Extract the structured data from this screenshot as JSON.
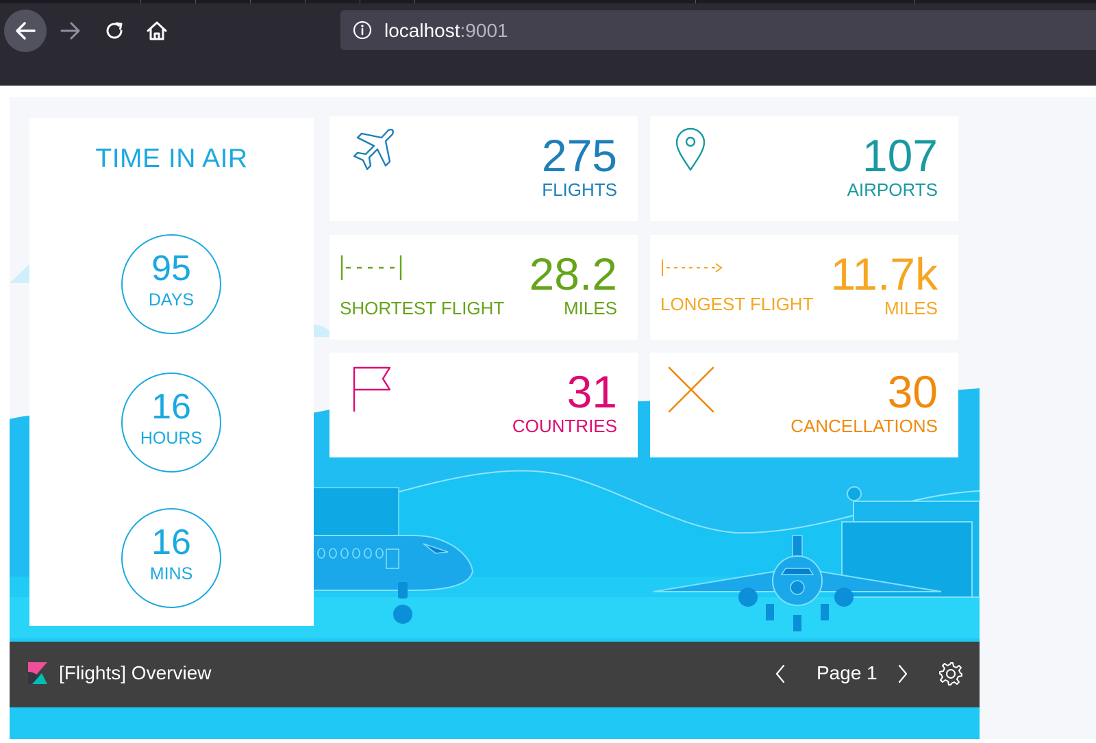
{
  "browser": {
    "url_host": "localhost",
    "url_port": ":9001",
    "icons": [
      "back-arrow-icon",
      "forward-arrow-icon",
      "reload-icon",
      "home-icon",
      "info-icon"
    ]
  },
  "time_in_air": {
    "title": "TIME IN AIR",
    "days": {
      "value": "95",
      "unit": "DAYS"
    },
    "hours": {
      "value": "16",
      "unit": "HOURS"
    },
    "mins": {
      "value": "16",
      "unit": "MINS"
    },
    "color": "#1ba9e0"
  },
  "metrics": {
    "flights": {
      "value": "275",
      "label": "FLIGHTS",
      "icon": "plane-icon",
      "color": "#1f7fb8"
    },
    "airports": {
      "value": "107",
      "label": "AIRPORTS",
      "icon": "map-pin-icon",
      "color": "#1a9aa0"
    },
    "shortest": {
      "value": "28.2",
      "label": "MILES",
      "title": "SHORTEST FLIGHT",
      "icon": "short-distance-icon",
      "color": "#66a41b"
    },
    "longest": {
      "value": "11.7k",
      "label": "MILES",
      "title": "LONGEST FLIGHT",
      "icon": "long-distance-icon",
      "color": "#f5a623"
    },
    "countries": {
      "value": "31",
      "label": "COUNTRIES",
      "icon": "flag-icon",
      "color": "#dd0a73"
    },
    "cancellations": {
      "value": "30",
      "label": "CANCELLATIONS",
      "icon": "x-icon",
      "color": "#f08a0e"
    }
  },
  "footer": {
    "workpad_name": "[Flights] Overview",
    "page_label": "Page 1",
    "icons": [
      "kibana-logo-icon",
      "chevron-left-icon",
      "chevron-right-icon",
      "gear-icon"
    ]
  }
}
